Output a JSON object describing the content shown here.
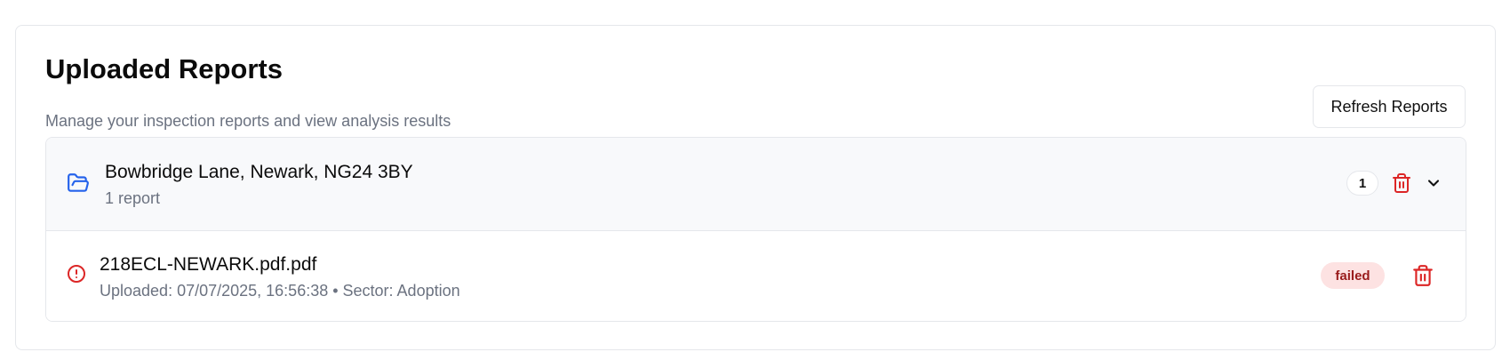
{
  "page": {
    "title": "Uploaded Reports",
    "subtitle": "Manage your inspection reports and view analysis results",
    "refresh_label": "Refresh Reports"
  },
  "groups": [
    {
      "name": "Bowbridge Lane, Newark, NG24 3BY",
      "count_text": "1 report",
      "badge_count": "1",
      "icon": "folder-open-icon",
      "reports": [
        {
          "filename": "218ECL-NEWARK.pdf.pdf",
          "meta": "Uploaded: 07/07/2025, 16:56:38 • Sector: Adoption",
          "status": "failed",
          "status_icon": "alert-circle-icon"
        }
      ]
    }
  ],
  "colors": {
    "folder_icon": "#2563eb",
    "danger": "#dc2626",
    "failed_badge_bg": "#fde2e2",
    "failed_badge_text": "#991b1b",
    "muted_text": "#6b7280",
    "group_header_bg": "#f8f9fb"
  }
}
